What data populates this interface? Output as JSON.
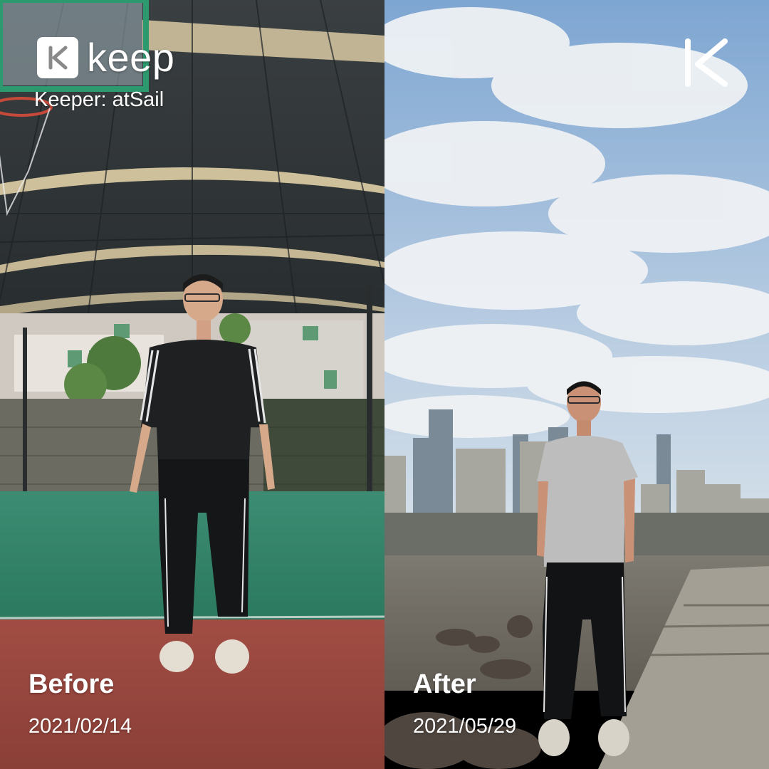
{
  "brand": {
    "logo_icon": "keep-k-logo-icon",
    "wordmark": "keep",
    "keeper_line": "Keeper: atSail"
  },
  "before": {
    "label": "Before",
    "date": "2021/02/14"
  },
  "after": {
    "label": "After",
    "date": "2021/05/29"
  },
  "colors": {
    "text": "#ffffff",
    "court_green": "#2f8a6a",
    "track_red": "#9a463e",
    "sky": "#8fb2d8",
    "roof": "#2f3436"
  }
}
